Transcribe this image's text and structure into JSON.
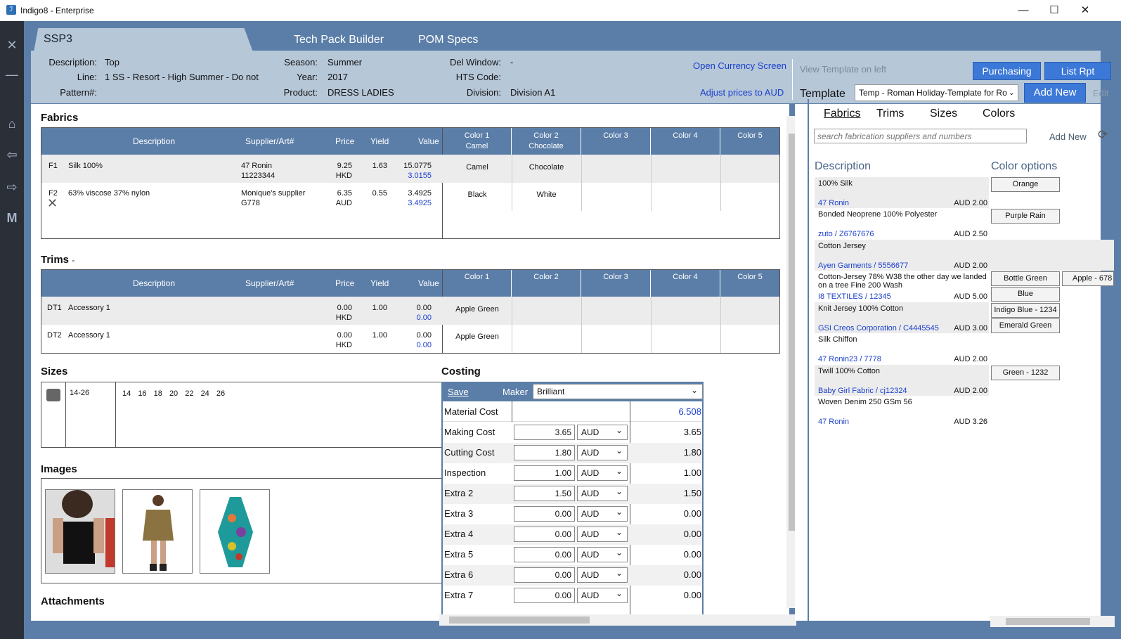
{
  "window": {
    "title": "Indigo8 - Enterprise"
  },
  "tabs": [
    {
      "label": "SSP3"
    },
    {
      "label": "Tech Pack Builder"
    },
    {
      "label": "POM Specs"
    }
  ],
  "header": {
    "description_label": "Description:",
    "description": "Top",
    "line_label": "Line:",
    "line": "1 SS - Resort - High Summer - Do not",
    "pattern_label": "Pattern#:",
    "pattern": "",
    "season_label": "Season:",
    "season": "Summer",
    "year_label": "Year:",
    "year": "2017",
    "product_label": "Product:",
    "product": "DRESS LADIES",
    "delwindow_label": "Del Window:",
    "delwindow": "-",
    "hts_label": "HTS Code:",
    "hts": "",
    "division_label": "Division:",
    "division": "Division A1",
    "open_currency": "Open Currency Screen",
    "adjust_prices": "Adjust prices to AUD",
    "view_template": "View Template on left",
    "purchasing": "Purchasing",
    "list_rpt": "List Rpt",
    "template_label": "Template",
    "template_value": "Temp - Roman Holiday-Template for Ro",
    "add_new": "Add New",
    "edit": "Edit"
  },
  "fabrics": {
    "title": "Fabrics",
    "headers": {
      "description": "Description",
      "supplier": "Supplier/Art#",
      "price": "Price",
      "yield": "Yield",
      "value": "Value"
    },
    "colors": [
      {
        "name": "Color 1",
        "sub": "Camel"
      },
      {
        "name": "Color 2",
        "sub": "Chocolate"
      },
      {
        "name": "Color 3",
        "sub": ""
      },
      {
        "name": "Color 4",
        "sub": ""
      },
      {
        "name": "Color 5",
        "sub": ""
      }
    ],
    "rows": [
      {
        "code": "F1",
        "desc": "Silk 100%",
        "supplier": "47 Ronin",
        "art": "11223344",
        "price": "9.25",
        "currency": "HKD",
        "yield": "1.63",
        "value": "15.0775",
        "value2": "3.0155",
        "c1": "Camel",
        "c2": "Chocolate"
      },
      {
        "code": "F2",
        "desc": "63% viscose 37% nylon",
        "supplier": "Monique's supplier",
        "art": "G778",
        "price": "6.35",
        "currency": "AUD",
        "yield": "0.55",
        "value": "3.4925",
        "value2": "3.4925",
        "c1": "Black",
        "c2": "White"
      }
    ]
  },
  "trims": {
    "title": "Trims",
    "suffix": "-",
    "headers": {
      "description": "Description",
      "supplier": "Supplier/Art#",
      "price": "Price",
      "yield": "Yield",
      "value": "Value"
    },
    "colors": [
      "Color 1",
      "Color 2",
      "Color 3",
      "Color 4",
      "Color 5"
    ],
    "rows": [
      {
        "code": "DT1",
        "desc": "Accessory 1",
        "price": "0.00",
        "currency": "HKD",
        "yield": "1.00",
        "value": "0.00",
        "value2": "0.00",
        "c1": "Apple Green"
      },
      {
        "code": "DT2",
        "desc": "Accessory 1",
        "price": "0.00",
        "currency": "HKD",
        "yield": "1.00",
        "value": "0.00",
        "value2": "0.00",
        "c1": "Apple Green"
      }
    ]
  },
  "sizes": {
    "title": "Sizes",
    "range": "14-26",
    "values": [
      "14",
      "16",
      "18",
      "20",
      "22",
      "24",
      "26"
    ]
  },
  "images": {
    "title": "Images"
  },
  "attachments": {
    "title": "Attachments"
  },
  "costing": {
    "title": "Costing",
    "save": "Save",
    "maker_label": "Maker",
    "maker": "Brilliant",
    "material_label": "Material Cost",
    "material_value": "6.508",
    "rows": [
      {
        "label": "Making Cost",
        "input": "3.65",
        "cur": "AUD",
        "value": "3.65"
      },
      {
        "label": "Cutting Cost",
        "input": "1.80",
        "cur": "AUD",
        "value": "1.80"
      },
      {
        "label": "Inspection",
        "input": "1.00",
        "cur": "AUD",
        "value": "1.00"
      },
      {
        "label": "Extra 2",
        "input": "1.50",
        "cur": "AUD",
        "value": "1.50"
      },
      {
        "label": "Extra 3",
        "input": "0.00",
        "cur": "AUD",
        "value": "0.00"
      },
      {
        "label": "Extra 4",
        "input": "0.00",
        "cur": "AUD",
        "value": "0.00"
      },
      {
        "label": "Extra 5",
        "input": "0.00",
        "cur": "AUD",
        "value": "0.00"
      },
      {
        "label": "Extra 6",
        "input": "0.00",
        "cur": "AUD",
        "value": "0.00"
      },
      {
        "label": "Extra 7",
        "input": "0.00",
        "cur": "AUD",
        "value": "0.00"
      }
    ]
  },
  "right": {
    "tabs": [
      "Fabrics",
      "Trims",
      "Sizes",
      "Colors"
    ],
    "search_placeholder": "search fabrication suppliers and numbers",
    "add_new": "Add New",
    "desc_header": "Description",
    "color_header": "Color options",
    "items": [
      {
        "desc": "100% Silk",
        "link": "47 Ronin",
        "price": "AUD 2.00",
        "colors": [
          "Orange"
        ],
        "shade": true
      },
      {
        "desc": "Bonded Neoprene 100% Polyester",
        "link": "zuto / Z6767676",
        "price": "AUD 2.50",
        "colors": [
          "Purple Rain"
        ],
        "shade": false
      },
      {
        "desc": "Cotton Jersey",
        "link": "Ayen Garments / 5556677",
        "price": "AUD 2.00",
        "colors": [],
        "shade": true
      },
      {
        "desc": "Cotton-Jersey 78% W38 the other day we landed on a tree Fine 200 Wash",
        "link": "I8 TEXTILES / 12345",
        "price": "AUD 5.00",
        "colors": [
          "Bottle Green",
          "Blue"
        ],
        "extra": "Apple - 678",
        "shade": false
      },
      {
        "desc": "Knit Jersey 100% Cotton",
        "link": "GSI Creos Corporation / C4445545",
        "price": "AUD 3.00",
        "colors": [
          "Indigo Blue - 1234",
          "Emerald Green"
        ],
        "shade": true
      },
      {
        "desc": "Silk Chiffon",
        "link": "47 Ronin23 / 7778",
        "price": "AUD 2.00",
        "colors": [],
        "shade": false
      },
      {
        "desc": "Twill 100% Cotton",
        "link": "Baby Girl Fabric / cj12324",
        "price": "AUD 2.00",
        "colors": [
          "Green - 1232"
        ],
        "shade": true
      },
      {
        "desc": "Woven Denim 250 GSm 56",
        "link": "47 Ronin",
        "price": "AUD 3.26",
        "colors": [],
        "shade": false
      }
    ]
  }
}
